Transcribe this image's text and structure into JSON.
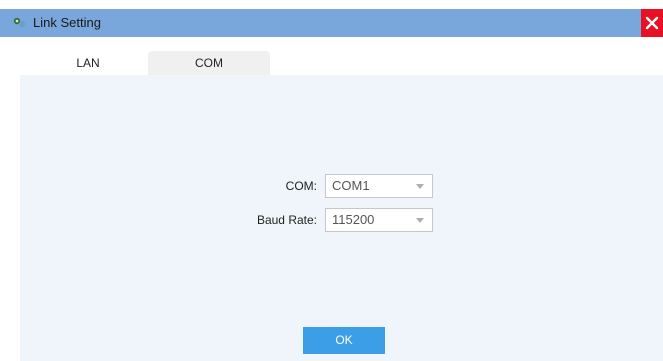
{
  "window": {
    "title": "Link Setting",
    "close_icon": "close-icon",
    "app_icon": "connection-icon"
  },
  "tabs": [
    {
      "label": "LAN"
    },
    {
      "label": "COM",
      "active": true
    }
  ],
  "form": {
    "com_label": "COM:",
    "com_value": "COM1",
    "baud_label": "Baud Rate:",
    "baud_value": "115200"
  },
  "ok_label": "OK",
  "colors": {
    "titlebar": "#7aa7db",
    "close": "#e81123",
    "accent": "#3d9ee8",
    "panel": "#f0f5fb"
  }
}
